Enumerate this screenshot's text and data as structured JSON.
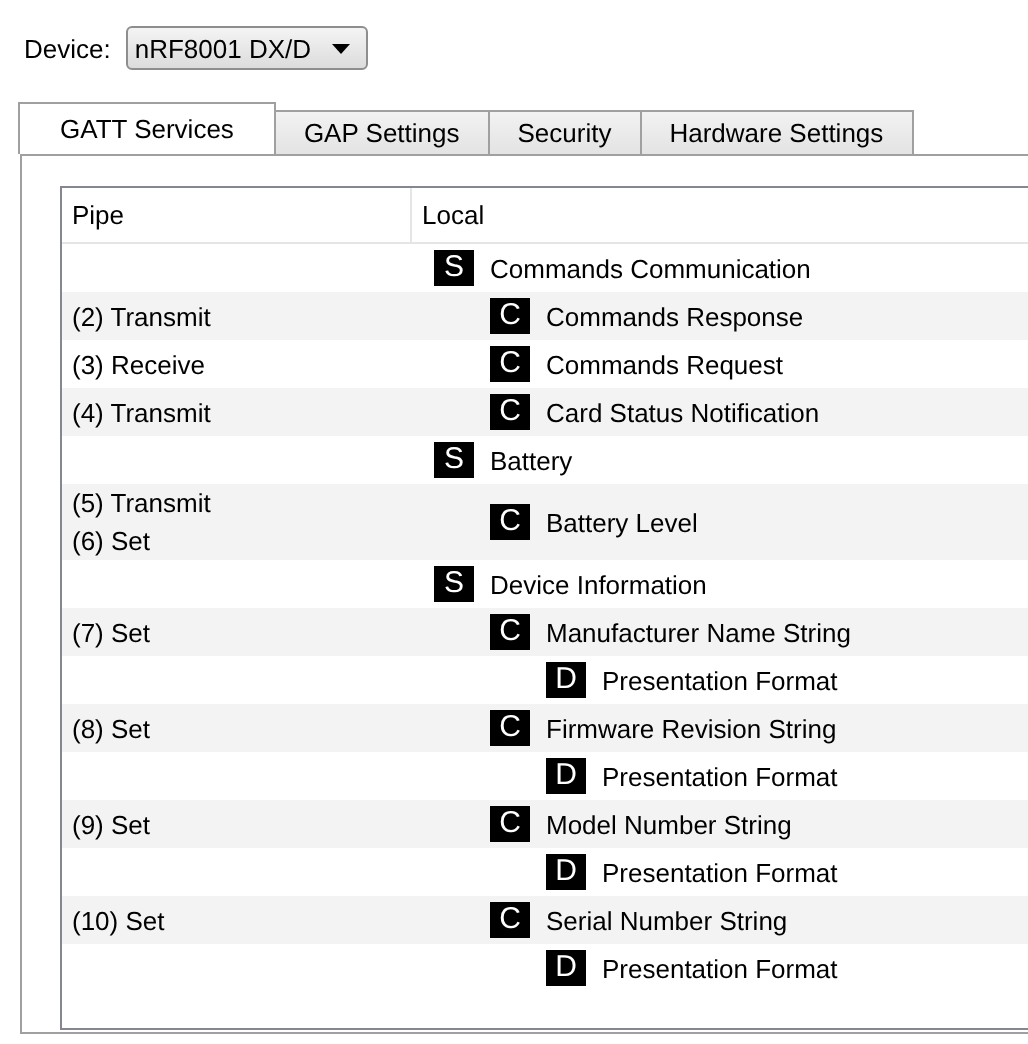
{
  "device": {
    "label": "Device:",
    "value": "nRF8001 DX/D"
  },
  "tabs": [
    {
      "label": "GATT Services",
      "selected": true
    },
    {
      "label": "GAP Settings",
      "selected": false
    },
    {
      "label": "Security",
      "selected": false
    },
    {
      "label": "Hardware Settings",
      "selected": false
    }
  ],
  "table": {
    "columns": [
      "Pipe",
      "Local"
    ],
    "rows": [
      {
        "badge": "S",
        "name": "Commands Communication",
        "children": [
          {
            "badge": "C",
            "name": "Commands Response",
            "pipe": [
              "(2) Transmit"
            ]
          },
          {
            "badge": "C",
            "name": "Commands Request",
            "pipe": [
              "(3) Receive"
            ]
          },
          {
            "badge": "C",
            "name": "Card Status Notification",
            "pipe": [
              "(4) Transmit"
            ]
          }
        ]
      },
      {
        "badge": "S",
        "name": "Battery",
        "children": [
          {
            "badge": "C",
            "name": "Battery Level",
            "pipe": [
              "(5) Transmit",
              "(6) Set"
            ]
          }
        ]
      },
      {
        "badge": "S",
        "name": "Device Information",
        "children": [
          {
            "badge": "C",
            "name": "Manufacturer Name String",
            "pipe": [
              "(7) Set"
            ],
            "children": [
              {
                "badge": "D",
                "name": "Presentation Format"
              }
            ]
          },
          {
            "badge": "C",
            "name": "Firmware Revision String",
            "pipe": [
              "(8) Set"
            ],
            "children": [
              {
                "badge": "D",
                "name": "Presentation Format"
              }
            ]
          },
          {
            "badge": "C",
            "name": "Model Number String",
            "pipe": [
              "(9) Set"
            ],
            "children": [
              {
                "badge": "D",
                "name": "Presentation Format"
              }
            ]
          },
          {
            "badge": "C",
            "name": "Serial Number String",
            "pipe": [
              "(10) Set"
            ],
            "children": [
              {
                "badge": "D",
                "name": "Presentation Format"
              }
            ]
          }
        ]
      }
    ]
  }
}
